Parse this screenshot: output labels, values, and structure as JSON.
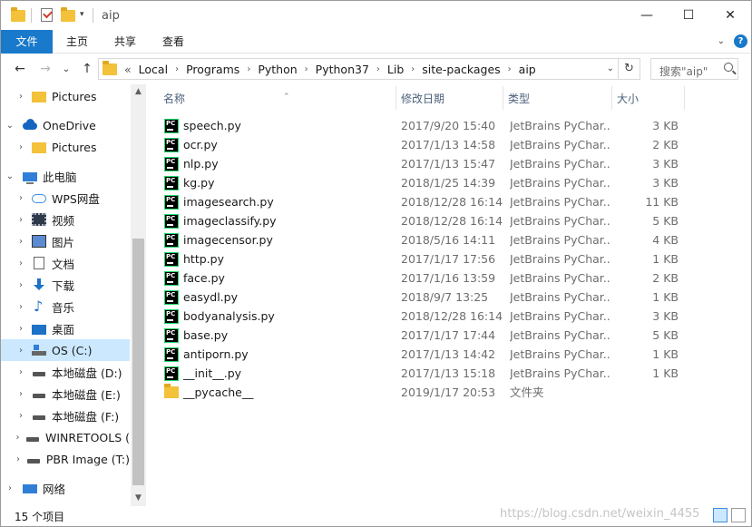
{
  "window": {
    "title": "aip",
    "controls": {
      "minimize": "—",
      "maximize": "☐",
      "close": "✕"
    }
  },
  "ribbon": {
    "tabs": [
      "文件",
      "主页",
      "共享",
      "查看"
    ],
    "collapse_glyph": "⌄",
    "help_glyph": "?"
  },
  "nav": {
    "back": "←",
    "forward": "→",
    "recent": "⌄",
    "up": "↑"
  },
  "address": {
    "overflow": "«",
    "crumbs": [
      "Local",
      "Programs",
      "Python",
      "Python37",
      "Lib",
      "site-packages",
      "aip"
    ],
    "separator": "›",
    "dropdown": "⌄",
    "refresh": "↻"
  },
  "search": {
    "placeholder": "搜索\"aip\""
  },
  "sidebar": {
    "items": [
      {
        "label": "Pictures",
        "icon": "folder-icon",
        "arrow": "›",
        "indent": 1
      },
      {
        "label": "OneDrive",
        "icon": "onedrive-icon",
        "arrow": "⌄",
        "indent": 0
      },
      {
        "label": "Pictures",
        "icon": "folder-icon",
        "arrow": "›",
        "indent": 1
      },
      {
        "label": "此电脑",
        "icon": "this-pc-icon",
        "arrow": "⌄",
        "indent": 0
      },
      {
        "label": "WPS网盘",
        "icon": "wps-cloud-icon",
        "arrow": "›",
        "indent": 1
      },
      {
        "label": "视频",
        "icon": "videos-icon",
        "arrow": "›",
        "indent": 1
      },
      {
        "label": "图片",
        "icon": "pictures-icon",
        "arrow": "›",
        "indent": 1
      },
      {
        "label": "文档",
        "icon": "documents-icon",
        "arrow": "›",
        "indent": 1
      },
      {
        "label": "下载",
        "icon": "downloads-icon",
        "arrow": "›",
        "indent": 1
      },
      {
        "label": "音乐",
        "icon": "music-icon",
        "arrow": "›",
        "indent": 1
      },
      {
        "label": "桌面",
        "icon": "desktop-icon",
        "arrow": "›",
        "indent": 1
      },
      {
        "label": "OS (C:)",
        "icon": "os-drive-icon",
        "arrow": "›",
        "indent": 1,
        "selected": true
      },
      {
        "label": "本地磁盘 (D:)",
        "icon": "drive-icon",
        "arrow": "›",
        "indent": 1
      },
      {
        "label": "本地磁盘 (E:)",
        "icon": "drive-icon",
        "arrow": "›",
        "indent": 1
      },
      {
        "label": "本地磁盘 (F:)",
        "icon": "drive-icon",
        "arrow": "›",
        "indent": 1
      },
      {
        "label": "WINRETOOLS (",
        "icon": "drive-icon",
        "arrow": "›",
        "indent": 1
      },
      {
        "label": "PBR Image (T:)",
        "icon": "drive-icon",
        "arrow": "›",
        "indent": 1
      },
      {
        "label": "网络",
        "icon": "network-icon",
        "arrow": "›",
        "indent": 0
      }
    ],
    "scroll_up": "▲",
    "scroll_down": "▼"
  },
  "columns": {
    "name": "名称",
    "date": "修改日期",
    "type": "类型",
    "size": "大小",
    "sort_caret": "⌃"
  },
  "files": [
    {
      "name": "speech.py",
      "date": "2017/9/20 15:40",
      "type": "JetBrains PyChar...",
      "size": "3 KB",
      "kind": "py"
    },
    {
      "name": "ocr.py",
      "date": "2017/1/13 14:58",
      "type": "JetBrains PyChar...",
      "size": "2 KB",
      "kind": "py"
    },
    {
      "name": "nlp.py",
      "date": "2017/1/13 15:47",
      "type": "JetBrains PyChar...",
      "size": "3 KB",
      "kind": "py"
    },
    {
      "name": "kg.py",
      "date": "2018/1/25 14:39",
      "type": "JetBrains PyChar...",
      "size": "3 KB",
      "kind": "py"
    },
    {
      "name": "imagesearch.py",
      "date": "2018/12/28 16:14",
      "type": "JetBrains PyChar...",
      "size": "11 KB",
      "kind": "py"
    },
    {
      "name": "imageclassify.py",
      "date": "2018/12/28 16:14",
      "type": "JetBrains PyChar...",
      "size": "5 KB",
      "kind": "py"
    },
    {
      "name": "imagecensor.py",
      "date": "2018/5/16 14:11",
      "type": "JetBrains PyChar...",
      "size": "4 KB",
      "kind": "py"
    },
    {
      "name": "http.py",
      "date": "2017/1/17 17:56",
      "type": "JetBrains PyChar...",
      "size": "1 KB",
      "kind": "py"
    },
    {
      "name": "face.py",
      "date": "2017/1/16 13:59",
      "type": "JetBrains PyChar...",
      "size": "2 KB",
      "kind": "py"
    },
    {
      "name": "easydl.py",
      "date": "2018/9/7 13:25",
      "type": "JetBrains PyChar...",
      "size": "1 KB",
      "kind": "py"
    },
    {
      "name": "bodyanalysis.py",
      "date": "2018/12/28 16:14",
      "type": "JetBrains PyChar...",
      "size": "3 KB",
      "kind": "py"
    },
    {
      "name": "base.py",
      "date": "2017/1/17 17:44",
      "type": "JetBrains PyChar...",
      "size": "5 KB",
      "kind": "py"
    },
    {
      "name": "antiporn.py",
      "date": "2017/1/13 14:42",
      "type": "JetBrains PyChar...",
      "size": "1 KB",
      "kind": "py"
    },
    {
      "name": "__init__.py",
      "date": "2017/1/13 15:18",
      "type": "JetBrains PyChar...",
      "size": "1 KB",
      "kind": "py"
    },
    {
      "name": "__pycache__",
      "date": "2019/1/17 20:53",
      "type": "文件夹",
      "size": "",
      "kind": "folder"
    }
  ],
  "status": {
    "count": "15 个项目",
    "watermark": "https://blog.csdn.net/weixin_4455"
  },
  "colors": {
    "accent": "#1979ca",
    "selected": "#cce8ff",
    "folder": "#f3c13a"
  }
}
